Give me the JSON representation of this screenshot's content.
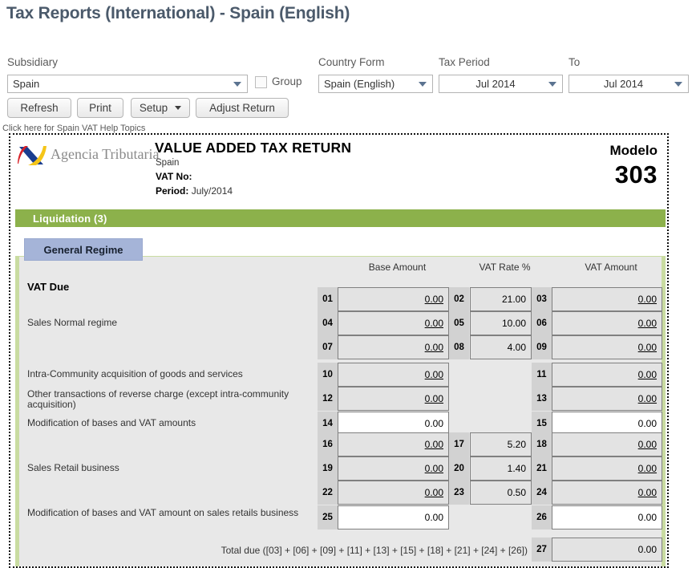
{
  "page_title": "Tax Reports (International) - Spain (English)",
  "filters": {
    "subsidiary": {
      "label": "Subsidiary",
      "value": "Spain"
    },
    "group": {
      "label": "Group",
      "checked": false
    },
    "country_form": {
      "label": "Country Form",
      "value": "Spain (English)"
    },
    "tax_period": {
      "label": "Tax Period",
      "value": "Jul 2014"
    },
    "to": {
      "label": "To",
      "value": "Jul 2014"
    }
  },
  "toolbar": {
    "refresh": "Refresh",
    "print": "Print",
    "setup": "Setup",
    "adjust_return": "Adjust Return"
  },
  "help_link": "Click here for Spain VAT Help Topics",
  "report": {
    "agency_name": "Agencia Tributaria",
    "title": "VALUE ADDED TAX RETURN",
    "country": "Spain",
    "vat_no_label": "VAT No:",
    "vat_no_value": "",
    "period_label": "Period:",
    "period_value": "July/2014",
    "modelo_label": "Modelo",
    "modelo_number": "303",
    "section_bar": "Liquidation (3)",
    "tab": "General Regime",
    "vat_due_label": "VAT Due",
    "columns": {
      "base_amount": "Base Amount",
      "vat_rate": "VAT Rate %",
      "vat_amount": "VAT Amount"
    },
    "rows": [
      {
        "label": "",
        "base_tag": "01",
        "base_value": "0.00",
        "base_link": true,
        "base_editable": false,
        "rate_tag": "02",
        "rate_value": "21.00",
        "rate_shown": true,
        "vat_tag": "03",
        "vat_value": "0.00",
        "vat_link": true,
        "vat_editable": false
      },
      {
        "label": "Sales Normal regime",
        "base_tag": "04",
        "base_value": "0.00",
        "base_link": true,
        "base_editable": false,
        "rate_tag": "05",
        "rate_value": "10.00",
        "rate_shown": true,
        "vat_tag": "06",
        "vat_value": "0.00",
        "vat_link": true,
        "vat_editable": false
      },
      {
        "label": "",
        "base_tag": "07",
        "base_value": "0.00",
        "base_link": true,
        "base_editable": false,
        "rate_tag": "08",
        "rate_value": "4.00",
        "rate_shown": true,
        "vat_tag": "09",
        "vat_value": "0.00",
        "vat_link": true,
        "vat_editable": false
      },
      {
        "label": "Intra-Community acquisition of goods and services",
        "base_tag": "10",
        "base_value": "0.00",
        "base_link": true,
        "base_editable": false,
        "rate_tag": "",
        "rate_value": "",
        "rate_shown": false,
        "vat_tag": "11",
        "vat_value": "0.00",
        "vat_link": true,
        "vat_editable": false
      },
      {
        "label": "Other transactions of reverse charge (except intra-community acquisition)",
        "base_tag": "12",
        "base_value": "0.00",
        "base_link": true,
        "base_editable": false,
        "rate_tag": "",
        "rate_value": "",
        "rate_shown": false,
        "vat_tag": "13",
        "vat_value": "0.00",
        "vat_link": true,
        "vat_editable": false
      },
      {
        "label": "Modification of bases and VAT amounts",
        "base_tag": "14",
        "base_value": "0.00",
        "base_link": false,
        "base_editable": true,
        "rate_tag": "",
        "rate_value": "",
        "rate_shown": false,
        "vat_tag": "15",
        "vat_value": "0.00",
        "vat_link": false,
        "vat_editable": true
      },
      {
        "label": "",
        "base_tag": "16",
        "base_value": "0.00",
        "base_link": true,
        "base_editable": false,
        "rate_tag": "17",
        "rate_value": "5.20",
        "rate_shown": true,
        "vat_tag": "18",
        "vat_value": "0.00",
        "vat_link": true,
        "vat_editable": false
      },
      {
        "label": "Sales Retail business",
        "base_tag": "19",
        "base_value": "0.00",
        "base_link": true,
        "base_editable": false,
        "rate_tag": "20",
        "rate_value": "1.40",
        "rate_shown": true,
        "vat_tag": "21",
        "vat_value": "0.00",
        "vat_link": true,
        "vat_editable": false
      },
      {
        "label": "",
        "base_tag": "22",
        "base_value": "0.00",
        "base_link": true,
        "base_editable": false,
        "rate_tag": "23",
        "rate_value": "0.50",
        "rate_shown": true,
        "vat_tag": "24",
        "vat_value": "0.00",
        "vat_link": true,
        "vat_editable": false
      },
      {
        "label": "Modification of bases and VAT amount on sales retails business",
        "base_tag": "25",
        "base_value": "0.00",
        "base_link": false,
        "base_editable": true,
        "rate_tag": "",
        "rate_value": "",
        "rate_shown": false,
        "vat_tag": "26",
        "vat_value": "0.00",
        "vat_link": false,
        "vat_editable": true
      }
    ],
    "total": {
      "label": "Total due ([03] + [06] + [09] + [11] + [13] + [15] + [18] + [21] + [24] + [26])",
      "tag": "27",
      "value": "0.00"
    }
  },
  "colors": {
    "title": "#4b5a6b",
    "section_green": "#8cb14b",
    "tab_blue": "#a5b4d8",
    "panel_bg": "#e8e8e8"
  }
}
